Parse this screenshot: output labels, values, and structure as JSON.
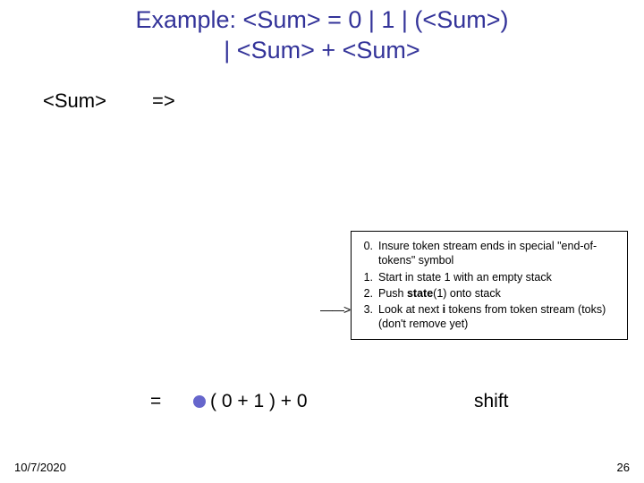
{
  "title_line1": "Example: <Sum> = 0 | 1 | (<Sum>)",
  "title_line2": "| <Sum> + <Sum>",
  "lhs": "<Sum>",
  "derives": "=>",
  "eq": "=",
  "expr": "( 0 + 1 ) + 0",
  "action": "shift",
  "algo": {
    "items": [
      {
        "n": "0.",
        "text_before": "Insure token stream ends in special \"end-of-tokens\" symbol",
        "bold": "",
        "text_after": ""
      },
      {
        "n": "1.",
        "text_before": "Start in state 1 with an empty stack",
        "bold": "",
        "text_after": ""
      },
      {
        "n": "2.",
        "text_before": "Push ",
        "bold": "state",
        "text_after": "(1) onto stack"
      },
      {
        "n": "3.",
        "text_before": "Look at next ",
        "bold": "i",
        "text_after": " tokens from token stream (toks) (don't remove yet)"
      }
    ],
    "pointer": "——>"
  },
  "footer": {
    "date": "10/7/2020",
    "page": "26"
  }
}
